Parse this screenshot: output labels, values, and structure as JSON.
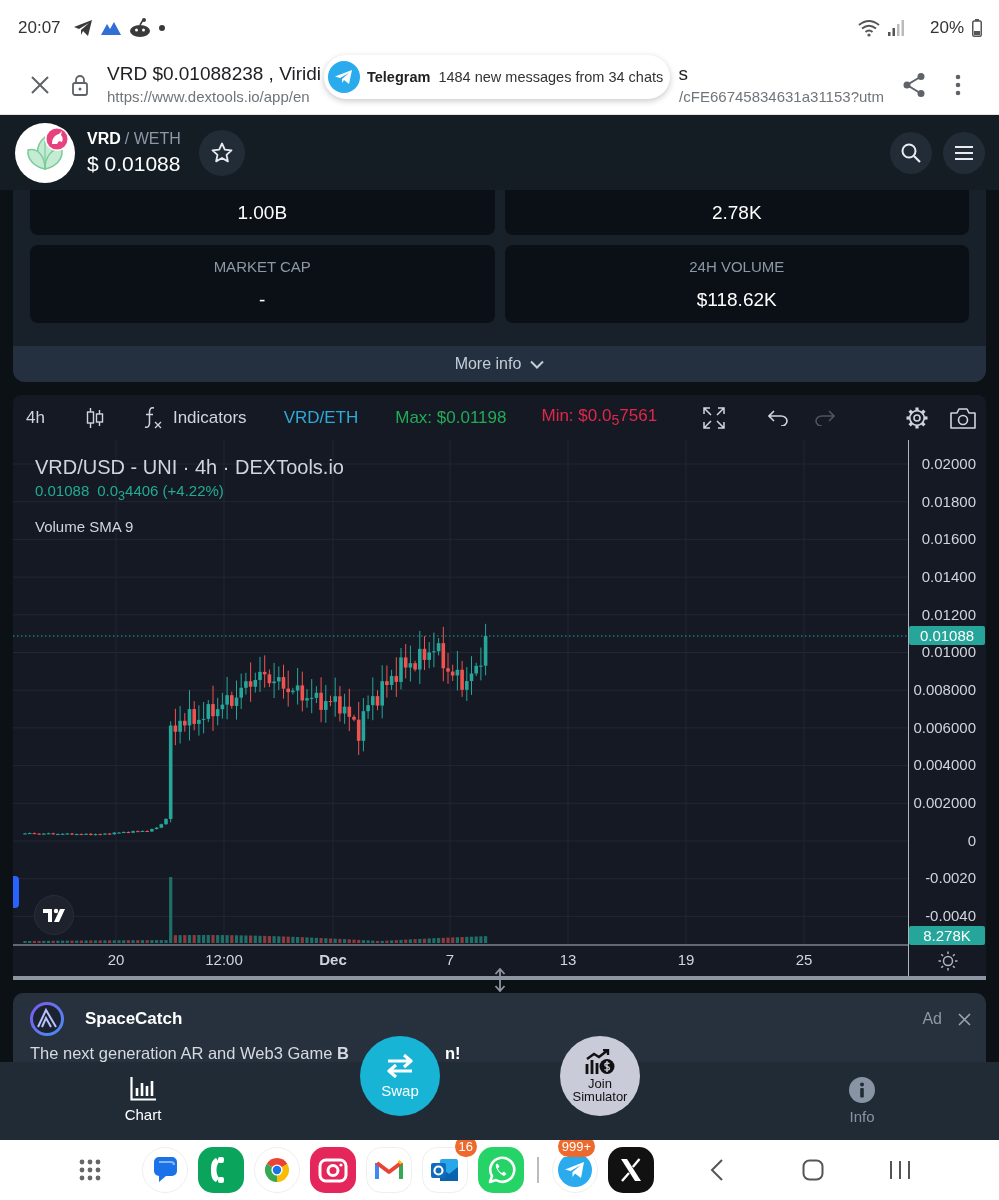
{
  "status_bar": {
    "time": "20:07",
    "battery": "20%"
  },
  "browser": {
    "title_start": "VRD $0.01088238 , Viridi",
    "title_end": "s",
    "url_start": "https://www.dextools.io/app/en",
    "url_end": "/cFE66745834631a31153?utm"
  },
  "notification": {
    "app": "Telegram",
    "message": "1484 new messages from 34 chats"
  },
  "pair": {
    "base": "VRD",
    "quote": "/ WETH",
    "price": "$ 0.01088",
    "favorite": false
  },
  "stats": [
    {
      "value": "1.00B"
    },
    {
      "value": "2.78K"
    },
    {
      "label": "MARKET CAP",
      "value": "-"
    },
    {
      "label": "24H VOLUME",
      "value": "$118.62K"
    }
  ],
  "more_info": {
    "label": "More info"
  },
  "chart_toolbar": {
    "interval": "4h",
    "indicators": "Indicators",
    "pair": "VRD/ETH",
    "max": "Max: $0.01198",
    "min": "Min: $0.0$_{5}$7561",
    "history": [
      {
        "kind": "undo",
        "disabled": false
      },
      {
        "kind": "redo",
        "disabled": true
      }
    ]
  },
  "chart": {
    "title": "VRD/USD - UNI · 4h · DEXTools.io",
    "last_value": "0.01088",
    "change": "0.0$_{3}$4406 (+4.22%)",
    "indicator": "Volume SMA 9",
    "price_labels": [
      "0.02000",
      "0.01800",
      "0.01600",
      "0.01400",
      "0.01200",
      "0.01000",
      "0.008000",
      "0.006000",
      "0.004000",
      "0.002000",
      "0",
      "-0.0020",
      "-0.0040"
    ],
    "last_price": "0.01088",
    "last_volume": "8.278K",
    "time_labels": [
      {
        "label": "20",
        "kind": "day"
      },
      {
        "label": "12:00",
        "kind": "time"
      },
      {
        "label": "Dec",
        "kind": "month"
      },
      {
        "label": "7",
        "kind": "day"
      },
      {
        "label": "13",
        "kind": "day"
      },
      {
        "label": "19",
        "kind": "day"
      },
      {
        "label": "25",
        "kind": "day"
      }
    ]
  },
  "ad": {
    "sponsor": "SpaceCatch",
    "badge": "Ad",
    "text_start": "The next generation AR and Web3 Game **B**",
    "text_end": "n!"
  },
  "bottom_nav": [
    {
      "kind": "chart",
      "label": "Chart",
      "selected": true
    },
    {
      "kind": "swap",
      "label": "Swap",
      "selected": false
    },
    {
      "kind": "simulator",
      "label": "Join Simulator",
      "selected": false
    },
    {
      "kind": "info",
      "label": "Info",
      "selected": false
    }
  ],
  "dock": {
    "apps": [
      {
        "kind": "chat"
      },
      {
        "kind": "phone"
      },
      {
        "kind": "browser"
      },
      {
        "kind": "camera"
      },
      {
        "kind": "mail"
      },
      {
        "kind": "office-mail",
        "badge": "16"
      },
      {
        "kind": "messenger"
      }
    ],
    "recent_apps": [
      {
        "kind": "plane",
        "badge": "999+"
      },
      {
        "kind": "x"
      }
    ]
  }
}
